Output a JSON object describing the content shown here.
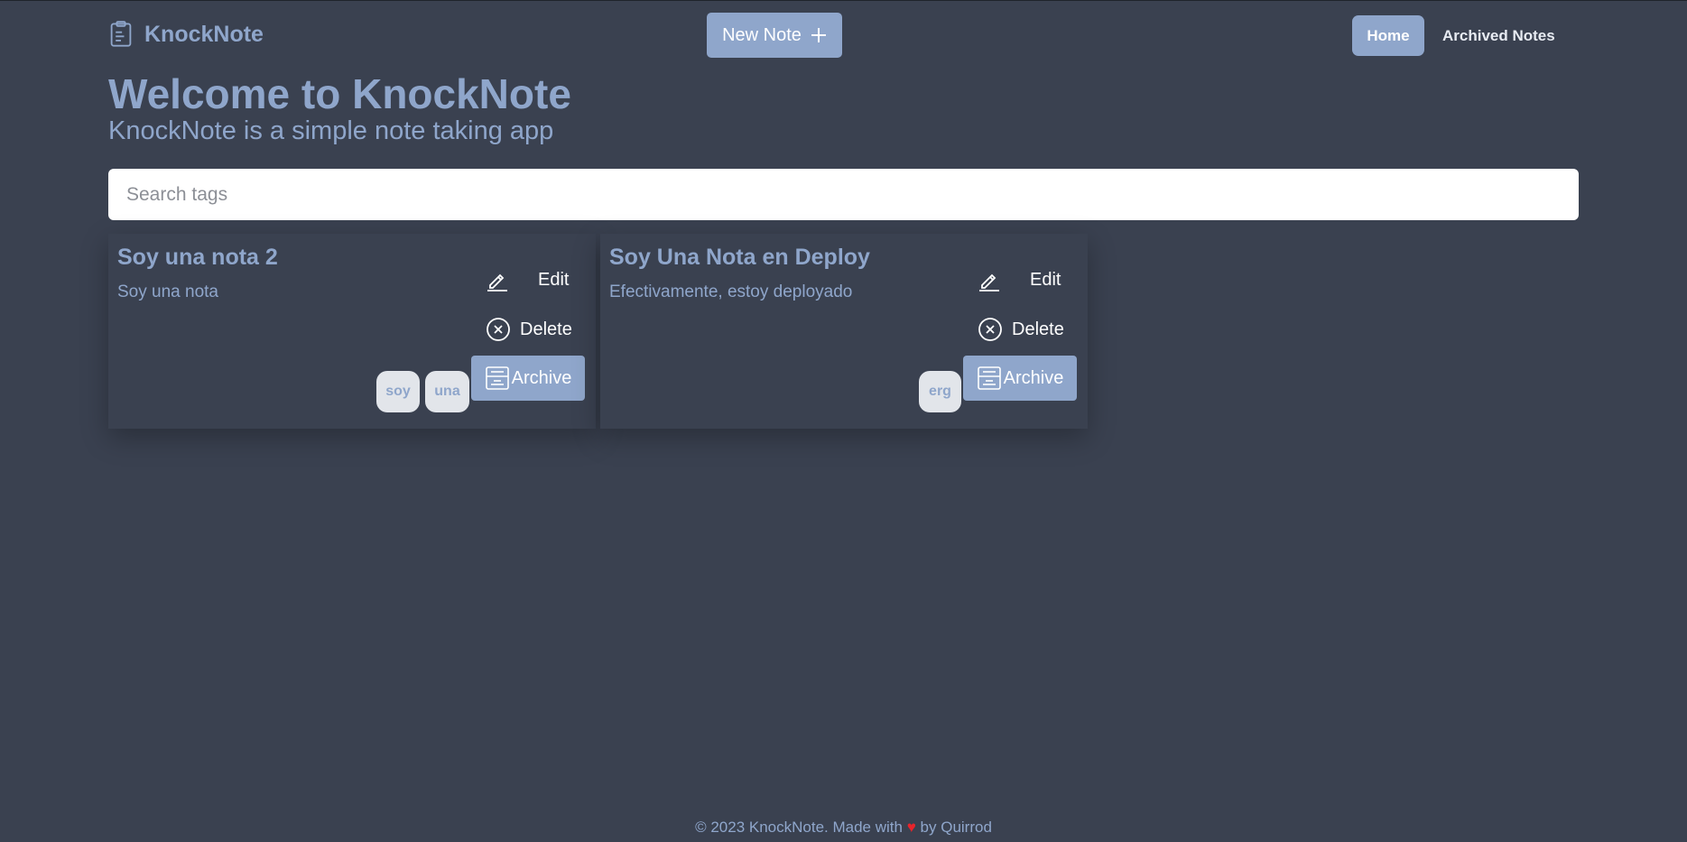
{
  "header": {
    "brand": "KnockNote",
    "new_note_label": "New Note",
    "nav": {
      "home": "Home",
      "archived": "Archived Notes"
    }
  },
  "hero": {
    "title": "Welcome to KnockNote",
    "subtitle": "KnockNote is a simple note taking app"
  },
  "search": {
    "placeholder": "Search tags",
    "value": ""
  },
  "notes": [
    {
      "title": "Soy una nota 2",
      "content": "Soy una nota",
      "edit_label": "Edit",
      "delete_label": "Delete",
      "archive_label": "Archive",
      "tags": [
        "soy",
        "una"
      ]
    },
    {
      "title": "Soy Una Nota en Deploy",
      "content": "Efectivamente, estoy deployado",
      "edit_label": "Edit",
      "delete_label": "Delete",
      "archive_label": "Archive",
      "tags": [
        "erg"
      ]
    }
  ],
  "footer": {
    "prefix": "© 2023 KnockNote. Made with",
    "heart": "♥",
    "by": "by",
    "author": "Quirrod"
  },
  "colors": {
    "background": "#3a4150",
    "accent": "#8fa6cb",
    "tag_bg": "#e2e5ea",
    "heart": "#e8242b"
  },
  "icons": [
    "clipboard-icon",
    "plus-icon",
    "pencil-icon",
    "close-circle-icon",
    "archive-icon",
    "heart-icon"
  ]
}
